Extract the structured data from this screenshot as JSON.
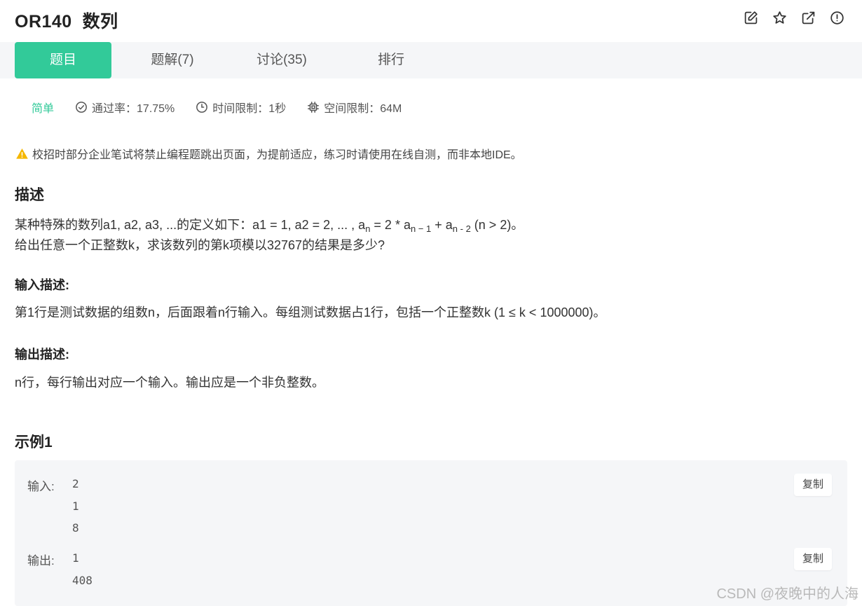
{
  "header": {
    "title": "OR140  数列",
    "icons": [
      "edit-icon",
      "star-icon",
      "external-link-icon",
      "report-icon"
    ]
  },
  "tabs": [
    {
      "label": "题目",
      "active": true
    },
    {
      "label": "题解(7)",
      "active": false
    },
    {
      "label": "讨论(35)",
      "active": false
    },
    {
      "label": "排行",
      "active": false
    }
  ],
  "meta": {
    "difficulty": "简单",
    "pass_rate": "通过率：17.75%",
    "time_limit": "时间限制：1秒",
    "memory_limit": "空间限制：64M"
  },
  "notice": "校招时部分企业笔试将禁止编程题跳出页面，为提前适应，练习时请使用在线自测，而非本地IDE。",
  "description": {
    "heading": "描述",
    "line1_before": "某种特殊的数列a1, a2, a3, ...的定义如下：a1 = 1, a2 = 2, ... , a",
    "sub_n": "n",
    "line1_mid1": " = 2 * a",
    "sub_n1": "n − 1",
    "line1_mid2": " + a",
    "sub_n2": "n - 2",
    "line1_after": " (n > 2)。",
    "line2": "给出任意一个正整数k，求该数列的第k项模以32767的结果是多少?"
  },
  "input_desc": {
    "heading": "输入描述:",
    "text": "第1行是测试数据的组数n，后面跟着n行输入。每组测试数据占1行，包括一个正整数k (1 ≤ k < 1000000)。"
  },
  "output_desc": {
    "heading": "输出描述:",
    "text": "n行，每行输出对应一个输入。输出应是一个非负整数。"
  },
  "example": {
    "heading": "示例1",
    "input_label": "输入:",
    "input_lines": [
      "2",
      "1",
      "8"
    ],
    "output_label": "输出:",
    "output_lines": [
      "1",
      "408"
    ],
    "copy_label": "复制"
  },
  "watermark": "CSDN @夜晚中的人海",
  "colors": {
    "accent": "#32ca99",
    "tab_bar_bg": "#f5f6f8",
    "warning": "#f5b700"
  }
}
